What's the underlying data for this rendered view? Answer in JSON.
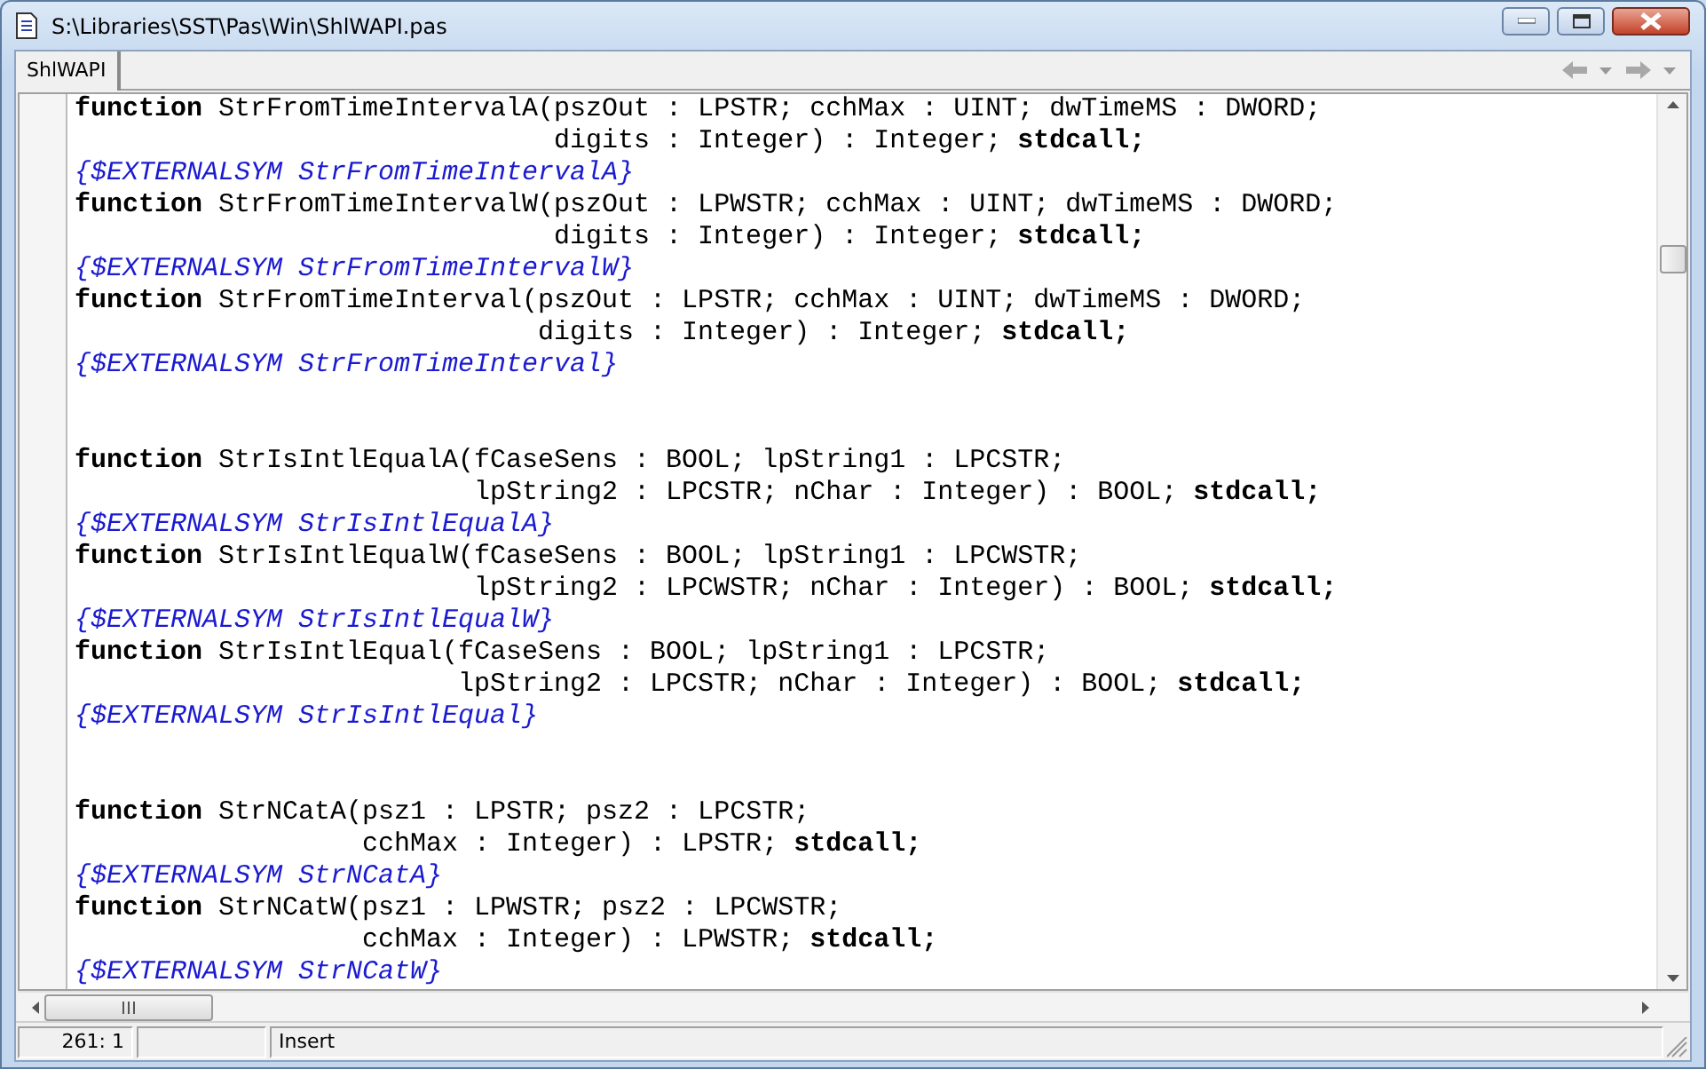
{
  "window": {
    "title": "S:\\Libraries\\SST\\Pas\\Win\\ShlWAPI.pas"
  },
  "tabs": [
    {
      "label": "ShlWAPI",
      "selected": true
    }
  ],
  "navigation": {
    "back_disabled": true,
    "forward_disabled": true
  },
  "editor": {
    "lines": [
      {
        "kind": "code",
        "text": "**function** StrFromTimeIntervalA(pszOut : LPSTR; cchMax : UINT; dwTimeMS : DWORD;"
      },
      {
        "kind": "code",
        "text": "                              digits : Integer) : Integer; **stdcall;**"
      },
      {
        "kind": "directive",
        "text": "{$EXTERNALSYM StrFromTimeIntervalA}"
      },
      {
        "kind": "code",
        "text": "**function** StrFromTimeIntervalW(pszOut : LPWSTR; cchMax : UINT; dwTimeMS : DWORD;"
      },
      {
        "kind": "code",
        "text": "                              digits : Integer) : Integer; **stdcall;**"
      },
      {
        "kind": "directive",
        "text": "{$EXTERNALSYM StrFromTimeIntervalW}"
      },
      {
        "kind": "code",
        "text": "**function** StrFromTimeInterval(pszOut : LPSTR; cchMax : UINT; dwTimeMS : DWORD;"
      },
      {
        "kind": "code",
        "text": "                             digits : Integer) : Integer; **stdcall;**"
      },
      {
        "kind": "directive",
        "text": "{$EXTERNALSYM StrFromTimeInterval}"
      },
      {
        "kind": "blank"
      },
      {
        "kind": "blank"
      },
      {
        "kind": "code",
        "text": "**function** StrIsIntlEqualA(fCaseSens : BOOL; lpString1 : LPCSTR;"
      },
      {
        "kind": "code",
        "text": "                         lpString2 : LPCSTR; nChar : Integer) : BOOL; **stdcall;**"
      },
      {
        "kind": "directive",
        "text": "{$EXTERNALSYM StrIsIntlEqualA}"
      },
      {
        "kind": "code",
        "text": "**function** StrIsIntlEqualW(fCaseSens : BOOL; lpString1 : LPCWSTR;"
      },
      {
        "kind": "code",
        "text": "                         lpString2 : LPCWSTR; nChar : Integer) : BOOL; **stdcall;**"
      },
      {
        "kind": "directive",
        "text": "{$EXTERNALSYM StrIsIntlEqualW}"
      },
      {
        "kind": "code",
        "text": "**function** StrIsIntlEqual(fCaseSens : BOOL; lpString1 : LPCSTR;"
      },
      {
        "kind": "code",
        "text": "                        lpString2 : LPCSTR; nChar : Integer) : BOOL; **stdcall;**"
      },
      {
        "kind": "directive",
        "text": "{$EXTERNALSYM StrIsIntlEqual}"
      },
      {
        "kind": "blank"
      },
      {
        "kind": "blank"
      },
      {
        "kind": "code",
        "text": "**function** StrNCatA(psz1 : LPSTR; psz2 : LPCSTR;"
      },
      {
        "kind": "code",
        "text": "                  cchMax : Integer) : LPSTR; **stdcall;**"
      },
      {
        "kind": "directive",
        "text": "{$EXTERNALSYM StrNCatA}"
      },
      {
        "kind": "code",
        "text": "**function** StrNCatW(psz1 : LPWSTR; psz2 : LPCWSTR;"
      },
      {
        "kind": "code",
        "text": "                  cchMax : Integer) : LPWSTR; **stdcall;**"
      },
      {
        "kind": "directive",
        "text": "{$EXTERNALSYM StrNCatW}"
      }
    ]
  },
  "status_bar": {
    "position": "261:  1",
    "mode": "Insert"
  }
}
